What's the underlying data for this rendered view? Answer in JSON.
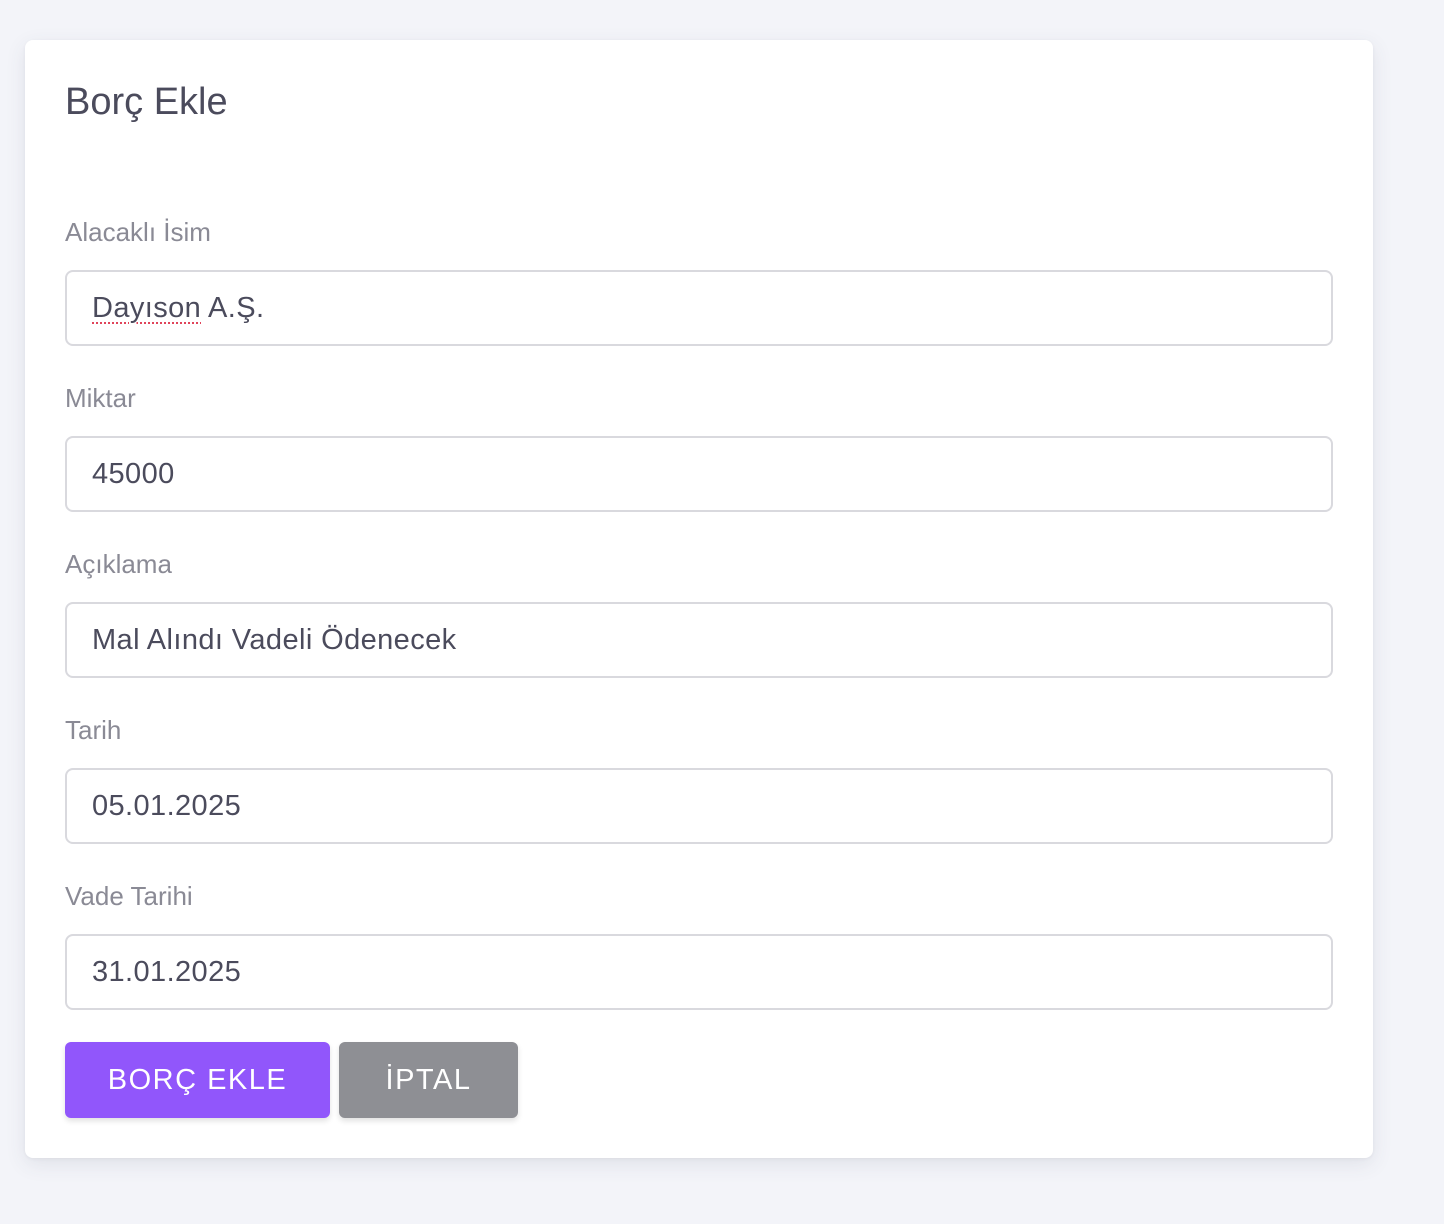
{
  "form": {
    "title": "Borç Ekle",
    "fields": [
      {
        "label": "Alacaklı İsim",
        "value_spell": "Dayıson",
        "value_rest": " A.Ş."
      },
      {
        "label": "Miktar",
        "value": "45000"
      },
      {
        "label": "Açıklama",
        "value": "Mal Alındı Vadeli Ödenecek"
      },
      {
        "label": "Tarih",
        "value": "05.01.2025"
      },
      {
        "label": "Vade Tarihi",
        "value": "31.01.2025"
      }
    ],
    "buttons": {
      "submit_label": "BORÇ EKLE",
      "cancel_label": "İPTAL"
    }
  },
  "colors": {
    "primary": "#9156fb",
    "secondary": "#8e8f94",
    "background": "#f3f4f9"
  }
}
